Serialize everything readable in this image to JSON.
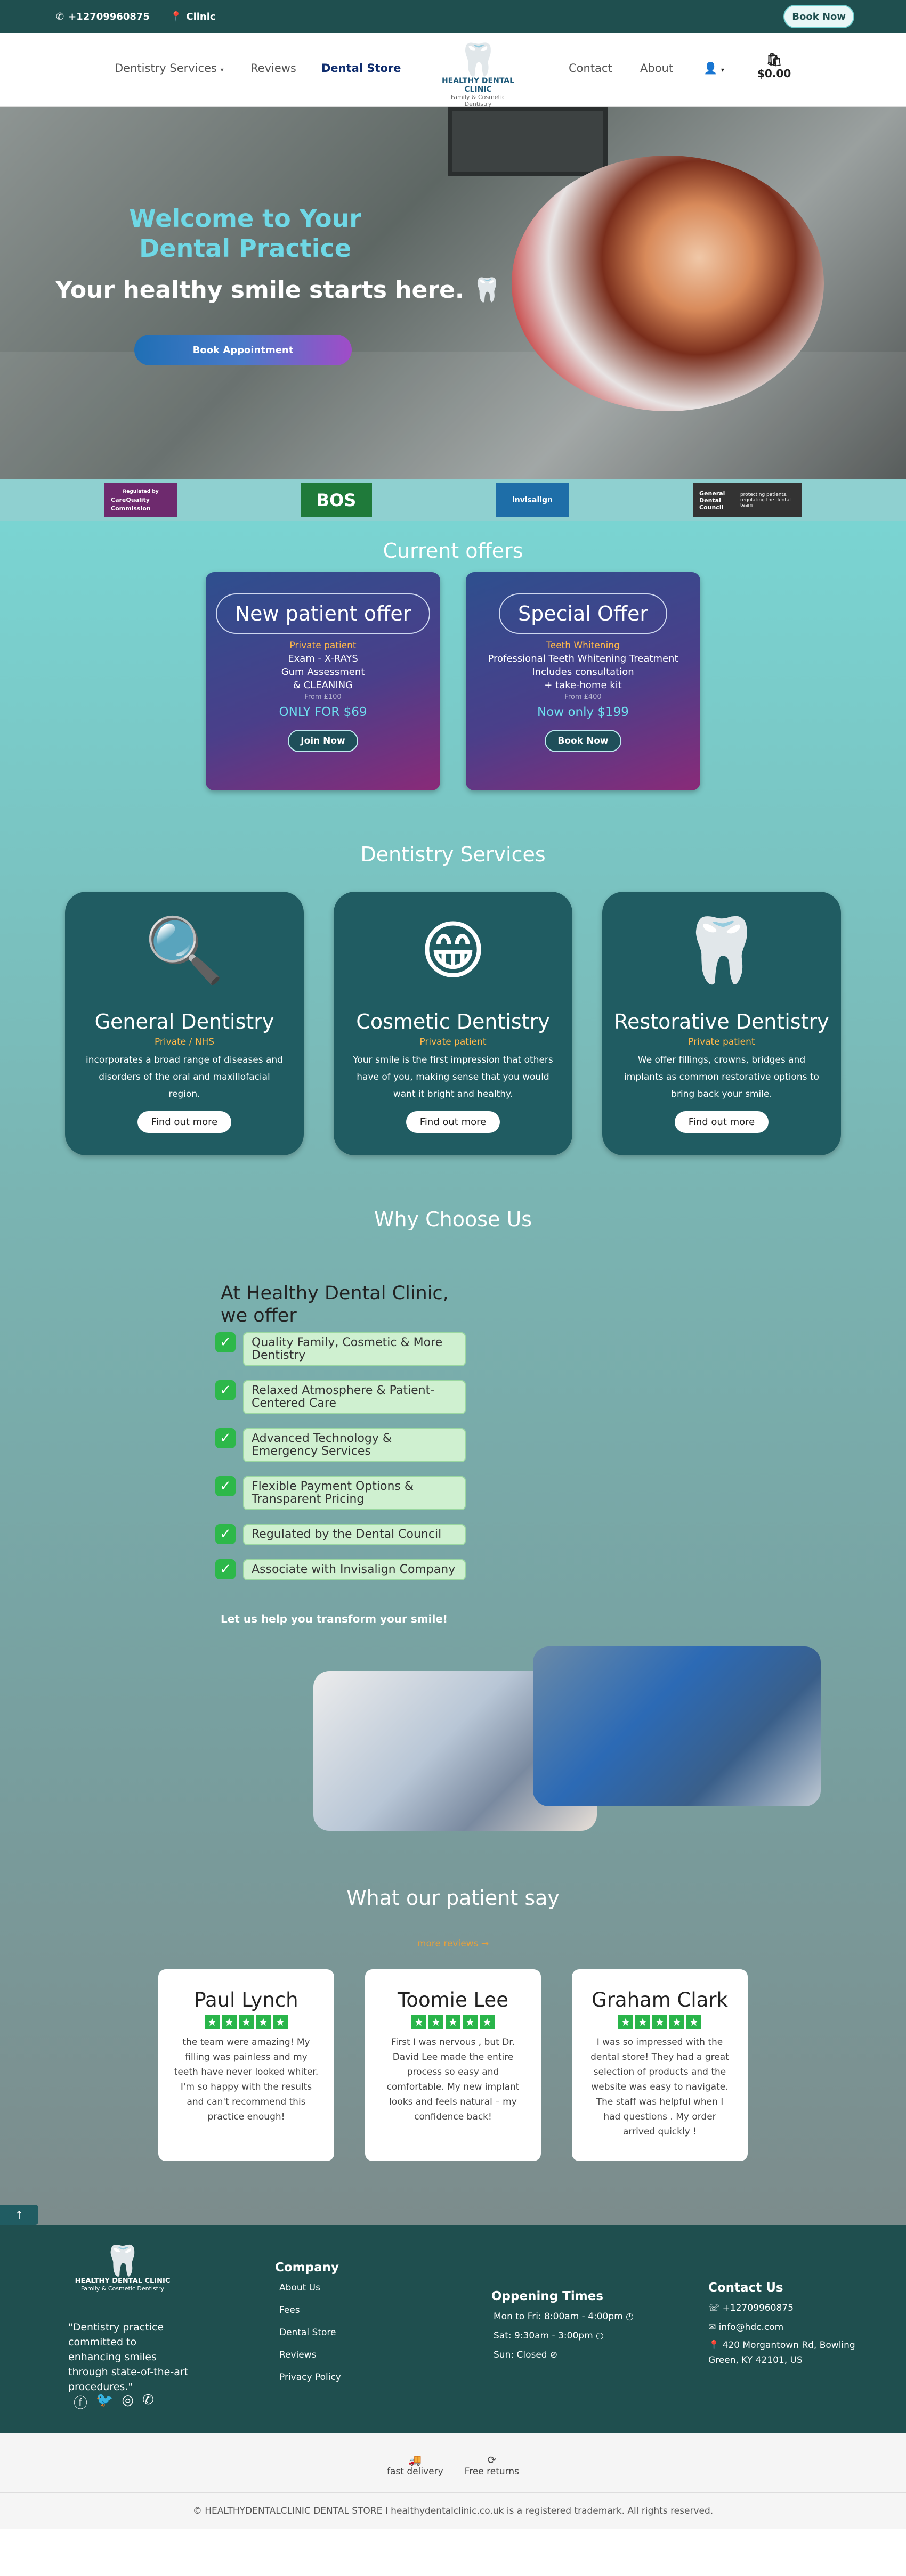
{
  "topbar": {
    "phone": "+12709960875",
    "clinic": "Clinic",
    "book": "Book Now"
  },
  "nav": {
    "services": "Dentistry Services",
    "reviews": "Reviews",
    "store": "Dental Store",
    "contact": "Contact",
    "about": "About",
    "cart_total": "$0.00",
    "logo_title": "HEALTHY DENTAL CLINIC",
    "logo_sub": "Family & Cosmetic Dentistry"
  },
  "hero": {
    "title": "Welcome to Your Dental Practice",
    "subtitle": "Your healthy smile starts here.",
    "emoji": "🦷",
    "button": "Book Appointment"
  },
  "accreditations": {
    "cqc_small": "Regulated by",
    "cqc": "CareQuality Commission",
    "bos": "BOS",
    "invisalign": "invisalign",
    "gdc": "General Dental Council",
    "gdc_tag": "protecting patients, regulating the dental team"
  },
  "offers": {
    "title": "Current offers",
    "items": [
      {
        "heading": "New patient offer",
        "sub": "Private patient",
        "lines": [
          "Exam - X-RAYS",
          "Gum Assessment",
          "& CLEANING"
        ],
        "strike": "From £100",
        "price": "ONLY FOR $69",
        "button": "Join Now"
      },
      {
        "heading": "Special Offer",
        "sub": "Teeth Whitening",
        "lines": [
          "Professional Teeth Whitening Treatment",
          "Includes consultation",
          "+ take-home kit"
        ],
        "strike": "From £400",
        "price": "Now only $199",
        "button": "Book Now"
      }
    ]
  },
  "services": {
    "title": "Dentistry Services",
    "items": [
      {
        "heading": "General Dentistry",
        "tag": "Private / NHS",
        "text": "incorporates a broad range of diseases and disorders of the oral and maxillofacial region.",
        "button": "Find out more"
      },
      {
        "heading": "Cosmetic Dentistry",
        "tag": "Private patient",
        "text": "Your smile is the first impression that others have of you, making sense that you would want it bright and healthy.",
        "button": "Find out more"
      },
      {
        "heading": "Restorative Dentistry",
        "tag": "Private patient",
        "text": "We offer fillings, crowns, bridges and implants as common restorative options to bring back your smile.",
        "button": "Find out more"
      }
    ]
  },
  "why": {
    "title": "Why Choose Us",
    "intro": "At Healthy Dental Clinic, we offer",
    "items": [
      "Quality Family, Cosmetic & More Dentistry",
      "Relaxed Atmosphere & Patient-Centered Care",
      "Advanced Technology & Emergency Services",
      "Flexible Payment Options & Transparent Pricing",
      "Regulated by the Dental Council",
      "Associate with Invisalign Company"
    ],
    "closing": "Let us help you transform your smile!"
  },
  "reviews": {
    "title": "What our patient say",
    "more": "more reviews",
    "items": [
      {
        "name": "Paul Lynch",
        "text": "the team were amazing! My filling was painless and my teeth have never looked whiter. I'm so happy with the results and can't recommend this practice enough!"
      },
      {
        "name": "Toomie Lee",
        "text": "First I was nervous , but Dr. David Lee made the entire process so easy and comfortable. My new implant looks and feels natural – my confidence back!"
      },
      {
        "name": "Graham Clark",
        "text": "I was so impressed with the dental store! They had a great selection of products and the website was easy to navigate. The staff was helpful when I had questions . My order arrived quickly !"
      }
    ]
  },
  "footer": {
    "logo_title": "HEALTHY DENTAL CLINIC",
    "logo_sub": "Family & Cosmetic Dentistry",
    "quote": "\"Dentistry practice committed to enhancing smiles through state-of-the-art procedures.\"",
    "company_title": "Company",
    "company_links": [
      "About Us",
      "Fees",
      "Dental Store",
      "Reviews",
      "Privacy Policy"
    ],
    "hours_title": "Oppening Times",
    "hours": [
      "Mon to Fri: 8:00am - 4:00pm",
      "Sat: 9:30am - 3:00pm",
      "Sun: Closed"
    ],
    "contact_title": "Contact Us",
    "contact": [
      "+12709960875",
      "info@hdc.com",
      "420 Morgantown Rd, Bowling Green, KY 42101, US"
    ]
  },
  "strip": {
    "delivery": "fast delivery",
    "returns": "Free returns"
  },
  "copyright": "© HEALTHYDENTALCLINIC DENTAL STORE I healthydentalclinic.co.uk is a registered trademark. All rights reserved."
}
